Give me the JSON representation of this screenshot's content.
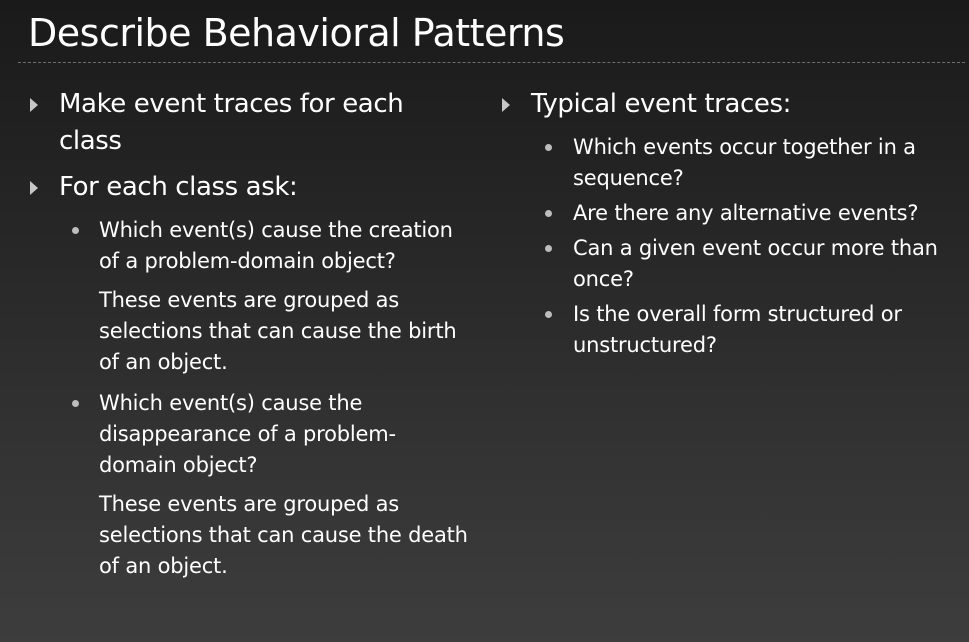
{
  "slide": {
    "title": "Describe Behavioral Patterns",
    "left_column": {
      "bullet1": "Make event traces for each class",
      "bullet2": "For each class ask:",
      "sub1": "Which event(s) cause the creation of a problem-domain object?",
      "sub1_note": "These events are grouped as selections that can cause the birth of an object.",
      "sub2": "Which event(s) cause the disappearance of a problem-domain object?",
      "sub2_note": "These events are grouped as selections that can cause the death of an object."
    },
    "right_column": {
      "bullet1": "Typical event traces:",
      "sub1": "Which events occur together in a sequence?",
      "sub2": "Are there any alternative events?",
      "sub3": "Can a given event occur more than once?",
      "sub4": "Is the overall form structured or unstructured?"
    }
  },
  "colors": {
    "background_top": "#1a1a1a",
    "background_bottom": "#3d3d3d",
    "text": "#ffffff",
    "bullet": "#c7c7c7"
  },
  "icons": {
    "level1_bullet": "triangle-right-icon",
    "level2_bullet": "dot-icon"
  }
}
